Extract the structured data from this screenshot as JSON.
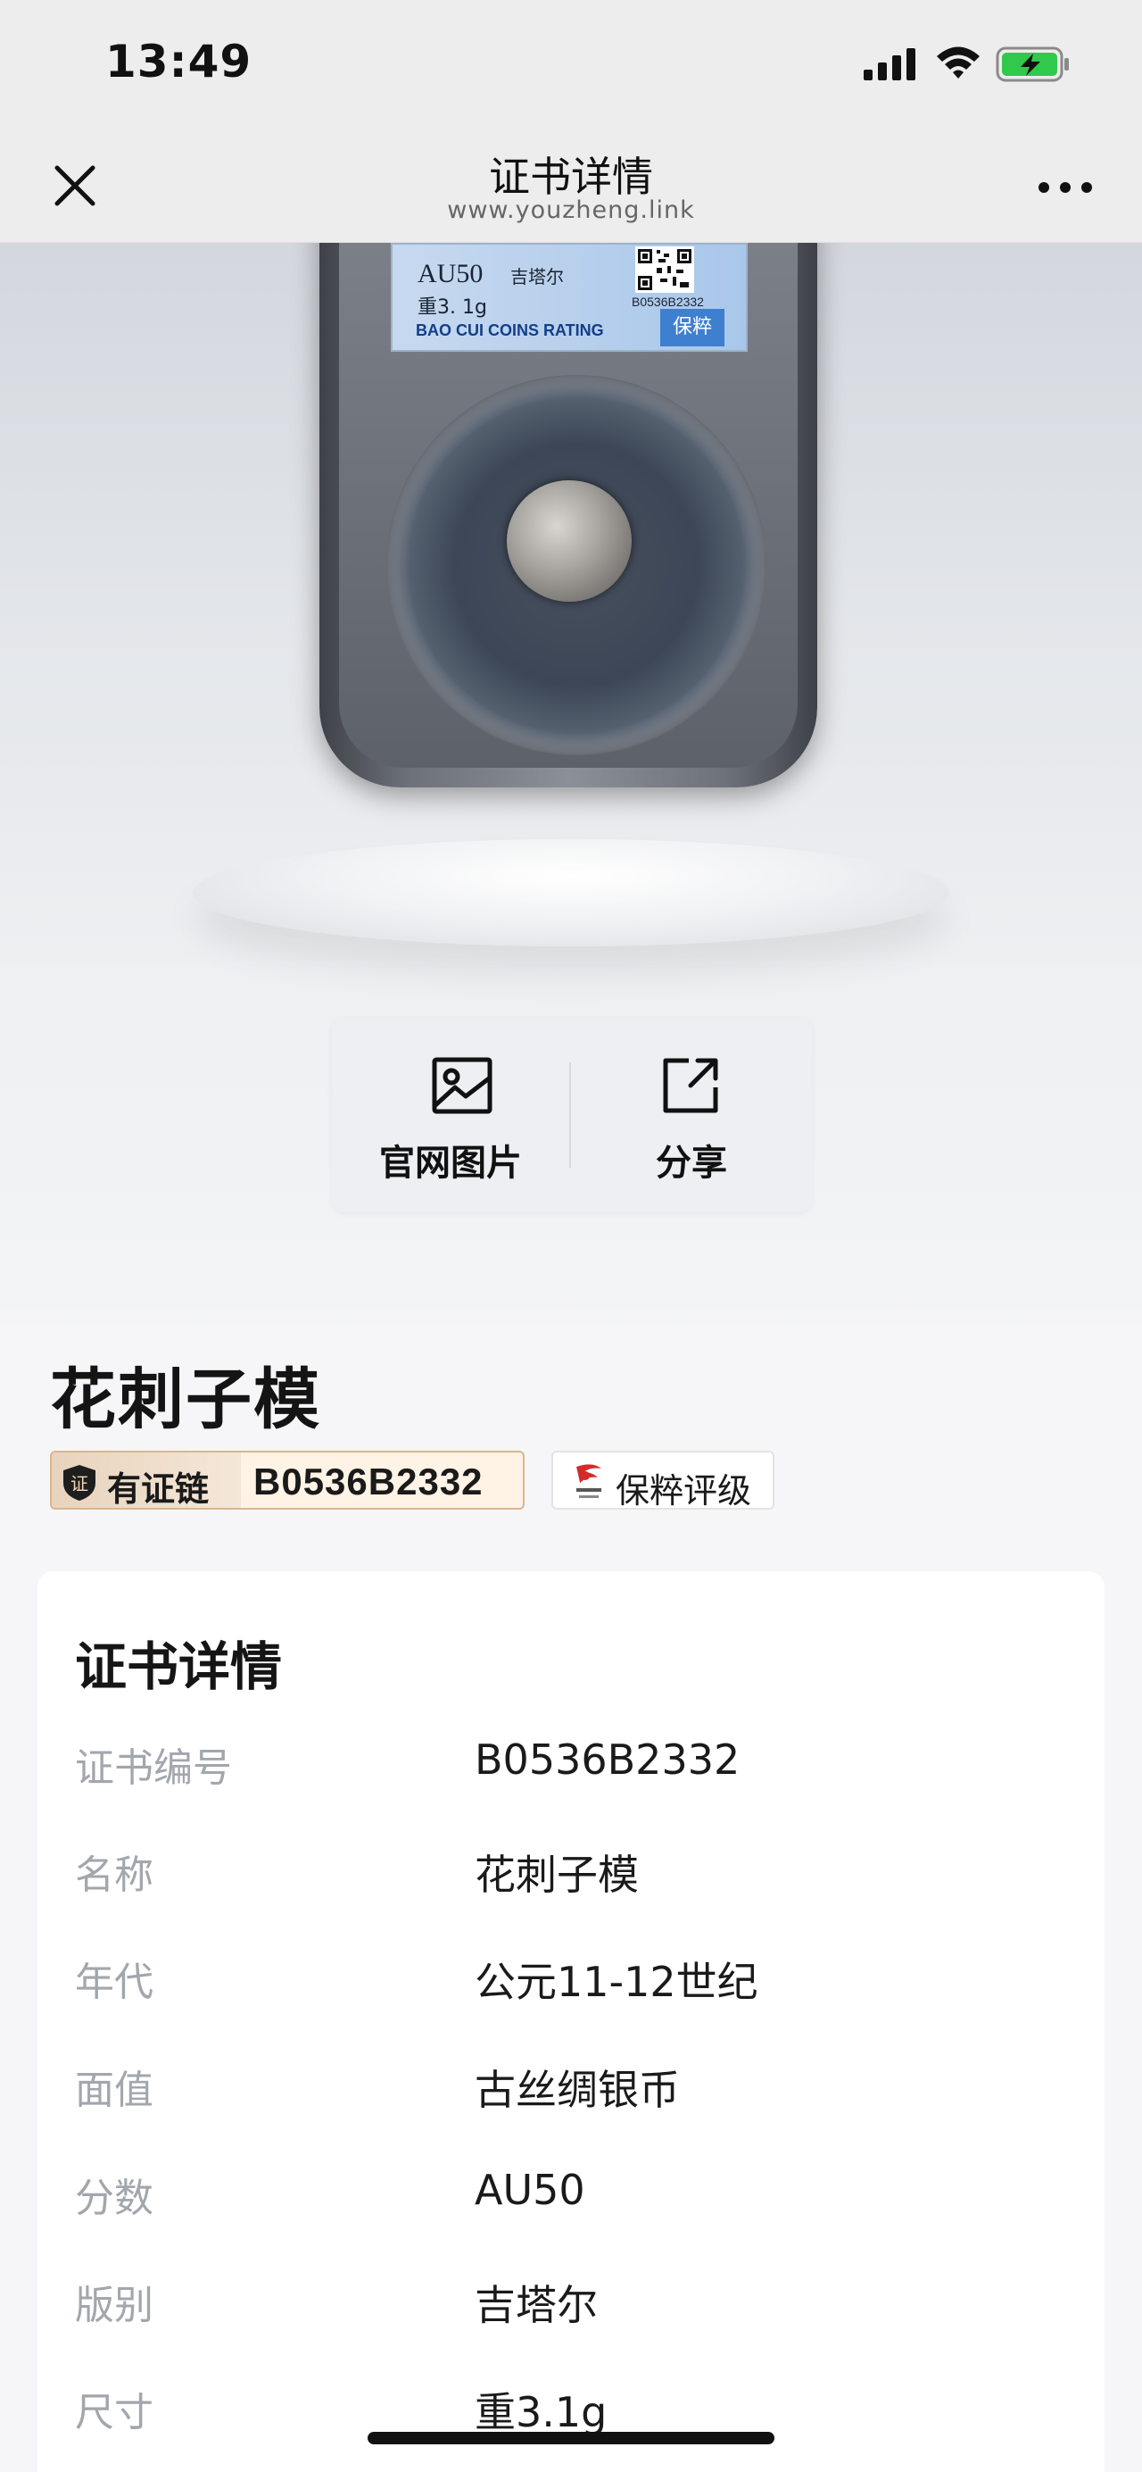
{
  "status_bar": {
    "time": "13:49"
  },
  "nav": {
    "title": "证书详情",
    "subtitle": "www.youzheng.link"
  },
  "slab_label": {
    "grade": "AU50",
    "version": "吉塔尔",
    "weight": "重3. 1g",
    "cert_no": "B0536B2332",
    "rating_text": "BAO CUI COINS RATING",
    "stamp": "保粹"
  },
  "actions": {
    "official_images": "官网图片",
    "share": "分享"
  },
  "item": {
    "title": "花刺子模",
    "chain_label": "有证链",
    "chain_code": "B0536B2332",
    "org_label": "保粹评级"
  },
  "details": {
    "title": "证书详情",
    "rows": [
      {
        "label": "证书编号",
        "value": "B0536B2332"
      },
      {
        "label": "名称",
        "value": "花刺子模"
      },
      {
        "label": "年代",
        "value": "公元11-12世纪"
      },
      {
        "label": "面值",
        "value": "古丝绸银币"
      },
      {
        "label": "分数",
        "value": "AU50"
      },
      {
        "label": "版别",
        "value": "吉塔尔"
      },
      {
        "label": "尺寸",
        "value": "重3.1g"
      }
    ]
  },
  "colors": {
    "chain_border": "#d9b68d",
    "label_blue": "#a9c7ea",
    "stamp_blue": "#3f7fcf",
    "muted_label": "#a2a6ad"
  }
}
